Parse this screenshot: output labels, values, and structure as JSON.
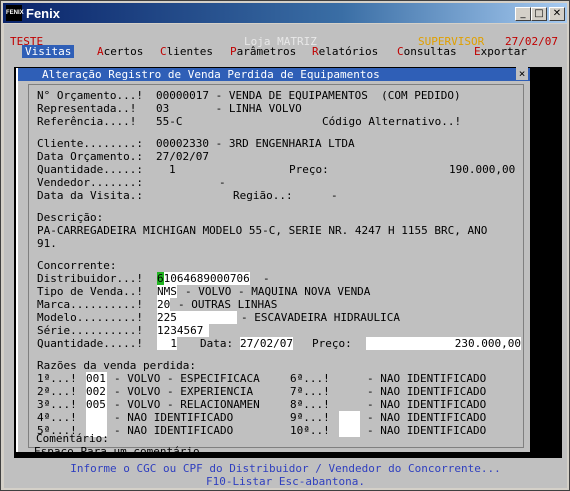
{
  "window": {
    "title": "Fenix",
    "icon_text": "FENIX"
  },
  "header": {
    "env": "TESTE",
    "store": "Loja MATRIZ",
    "user": "SUPERVISOR",
    "date": "27/02/07"
  },
  "menu": [
    {
      "hot": "V",
      "rest": "isitas"
    },
    {
      "hot": "A",
      "rest": "certos"
    },
    {
      "hot": "C",
      "rest": "lientes"
    },
    {
      "hot": "P",
      "rest": "arâmetros"
    },
    {
      "hot": "R",
      "rest": "elatórios"
    },
    {
      "hot": "C",
      "rest": "onsultas"
    },
    {
      "hot": "E",
      "rest": "xportar"
    }
  ],
  "dialog": {
    "title": "Alteração Registro de Venda Perdida de Equipamentos",
    "close": "×",
    "orcamento_label": "N° Orçamento...!",
    "orcamento_value": "00000017 - VENDA DE EQUIPAMENTOS  (COM PEDIDO)",
    "representada_label": "Representada..!",
    "representada_value": "03       - LINHA VOLVO",
    "referencia_label": "Referência....!",
    "referencia_value": "55-C",
    "codigo_alt": "Código Alternativo..!",
    "cliente_label": "Cliente........:",
    "cliente_value": "00002330 - 3RD ENGENHARIA LTDA",
    "data_orc_label": "Data Orçamento.:",
    "data_orc_value": "27/02/07",
    "quantidade_label": "Quantidade.....:",
    "quantidade_value": "1",
    "preco_label": "Preço:",
    "preco_value": "190.000,00",
    "vendedor_label": "Vendedor.......:",
    "vendedor_value": "-",
    "data_visita_label": "Data da Visita.:",
    "regiao_label": "Região..:",
    "regiao_value": "-",
    "descricao_label": "Descrição:",
    "descricao_line1": "PA-CARREGADEIRA MICHIGAN MODELO 55-C, SERIE NR. 4247 H 1155 BRC, ANO",
    "descricao_line2": "91.",
    "concorrente_label": "Concorrente:",
    "distribuidor_label": "Distribuidor...!",
    "distribuidor_first": "6",
    "distribuidor_rest": "1064689000706",
    "distribuidor_suffix": "-",
    "tipo_venda_label": "Tipo de Venda..!",
    "tipo_venda_code": "NMS",
    "tipo_venda_desc": "- VOLVO - MAQUINA NOVA VENDA",
    "marca_label": "Marca..........!",
    "marca_code": "20",
    "marca_desc": "- OUTRAS LINHAS",
    "modelo_label": "Modelo.........!",
    "modelo_code": "225",
    "modelo_desc": "- ESCAVADEIRA HIDRAULICA",
    "serie_label": "Série..........!",
    "serie_value": "1234567",
    "qtd2_label": "Quantidade.....!",
    "qtd2_value": "1",
    "data2_label": "Data:",
    "data2_value": "27/02/07",
    "preco2_label": "Preço:",
    "preco2_value": "230.000,00",
    "razoes_label": "Razões da venda perdida:",
    "razoes_left": [
      {
        "label": "1ª...!",
        "code": "001",
        "desc": "- VOLVO - ESPECIFICACA"
      },
      {
        "label": "2ª...!",
        "code": "002",
        "desc": "- VOLVO - EXPERIENCIA"
      },
      {
        "label": "3ª...!",
        "code": "005",
        "desc": "- VOLVO - RELACIONAMEN"
      },
      {
        "label": "4ª...!",
        "code": "",
        "desc": "- NAO IDENTIFICADO"
      },
      {
        "label": "5ª...!",
        "code": "",
        "desc": "- NAO IDENTIFICADO"
      }
    ],
    "razoes_right": [
      {
        "label": "6ª...!",
        "code": "",
        "desc": "- NAO IDENTIFICADO"
      },
      {
        "label": "7ª...!",
        "code": "",
        "desc": "- NAO IDENTIFICADO"
      },
      {
        "label": "8ª...!",
        "code": "",
        "desc": "- NAO IDENTIFICADO"
      },
      {
        "label": "9ª...!",
        "code": "",
        "desc": "- NAO IDENTIFICADO"
      },
      {
        "label": "10ª..!",
        "code": "",
        "desc": "- NAO IDENTIFICADO"
      }
    ],
    "comentario_label": "Comentário:",
    "comentario_value": "Espaço Para um comentário."
  },
  "footer": {
    "line1": "Informe o CGC ou CPF do Distribuidor / Vendedor do Concorrente...",
    "line2": "F10-Listar  Esc-abantona."
  },
  "colors": {
    "menu_active": "#2f5fb7",
    "hotkey": "#c00000",
    "highlight": "#21b521",
    "footer_text": "#2f3fbf",
    "user_text": "#e0a000",
    "env_text": "#c00000"
  }
}
